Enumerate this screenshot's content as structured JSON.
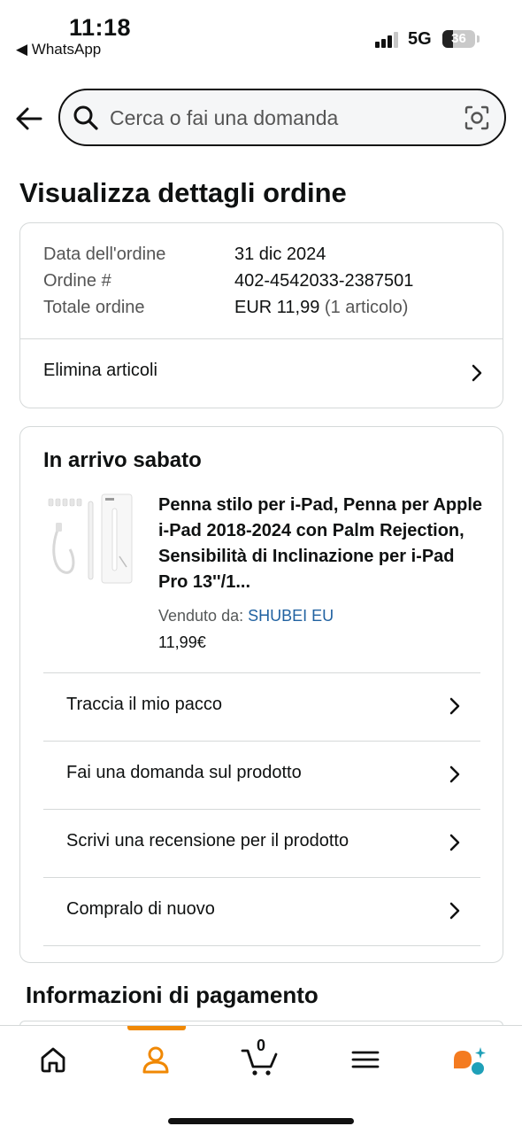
{
  "status_bar": {
    "time": "11:18",
    "back_app": "◀ WhatsApp",
    "network": "5G",
    "battery": "36"
  },
  "search": {
    "placeholder": "Cerca o fai una domanda"
  },
  "page_title": "Visualizza dettagli ordine",
  "order": {
    "date_label": "Data dell'ordine",
    "date_value": "31 dic 2024",
    "number_label": "Ordine #",
    "number_value": "402-4542033-2387501",
    "total_label": "Totale ordine",
    "total_value": "EUR 11,99",
    "total_items": "(1 articolo)",
    "delete_items_label": "Elimina articoli"
  },
  "shipment": {
    "title": "In arrivo sabato",
    "product_title": "Penna stilo per i-Pad, Penna per Apple i-Pad 2018-2024 con Palm Rejection, Sensibilità di Inclinazione per i-Pad Pro 13''/1...",
    "sold_by_label": "Venduto da:",
    "seller": "SHUBEI EU",
    "price": "11,99€",
    "actions": [
      "Traccia il mio pacco",
      "Fai una domanda sul prodotto",
      "Scrivi una recensione per il prodotto",
      "Compralo di nuovo"
    ]
  },
  "payment_title": "Informazioni di pagamento",
  "bottom_nav": {
    "cart_count": "0",
    "active_tab": "account",
    "accent_color": "#f08804",
    "icons": [
      "home-icon",
      "account-icon",
      "cart-icon",
      "menu-icon",
      "rufus-assistant-icon"
    ]
  }
}
